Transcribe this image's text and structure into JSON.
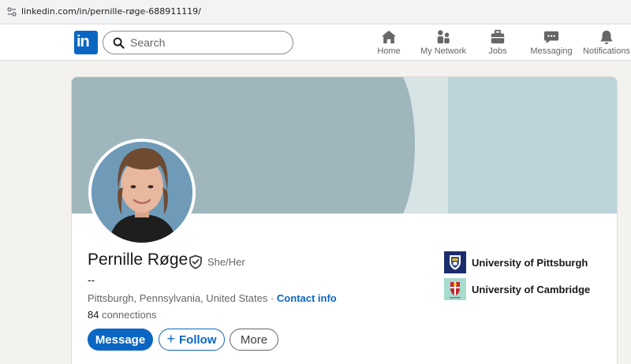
{
  "browser": {
    "url": "linkedin.com/in/pernille-røge-688911119/"
  },
  "nav": {
    "logo_text": "in",
    "search_placeholder": "Search",
    "items": [
      {
        "label": "Home",
        "icon": "home-icon"
      },
      {
        "label": "My Network",
        "icon": "network-icon"
      },
      {
        "label": "Jobs",
        "icon": "briefcase-icon"
      },
      {
        "label": "Messaging",
        "icon": "messaging-icon"
      },
      {
        "label": "Notifications",
        "icon": "bell-icon"
      }
    ]
  },
  "profile": {
    "name": "Pernille Røge",
    "pronouns": "She/Her",
    "headline": "--",
    "location": "Pittsburgh, Pennsylvania, United States",
    "separator": " · ",
    "contact_label": "Contact info",
    "connections_count": "84",
    "connections_label": " connections",
    "buttons": {
      "message": "Message",
      "follow": "Follow",
      "more": "More"
    },
    "education": [
      {
        "school": "University of Pittsburgh",
        "icon": "pitt-crest-icon"
      },
      {
        "school": "University of Cambridge",
        "icon": "cambridge-crest-icon"
      }
    ]
  },
  "colors": {
    "brand": "#0a66c2",
    "page_bg": "#f4f2ee",
    "banner_dark": "#a0b6bd",
    "banner_light": "#c2d8de"
  }
}
